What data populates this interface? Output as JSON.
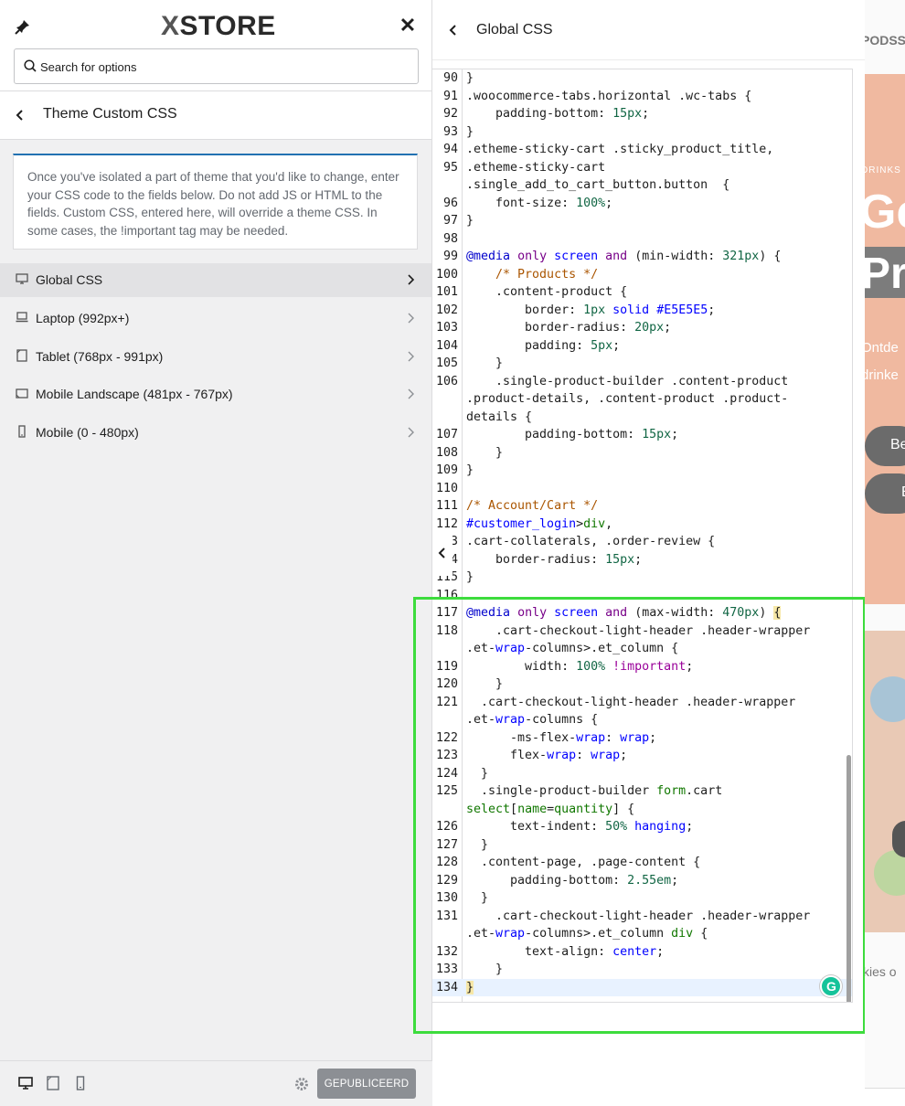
{
  "left_panel": {
    "logo": {
      "mark": "X",
      "text": "STORE"
    },
    "search": {
      "placeholder": "Search for options",
      "value": ""
    },
    "section_title": "Theme Custom CSS",
    "description": "Once you've isolated a part of theme that you'd like to change, enter your CSS code to the fields below. Do not add JS or HTML to the fields. Custom CSS, entered here, will override a theme CSS. In some cases, the !important tag may be needed.",
    "menu": [
      {
        "label": "Global CSS",
        "icon": "desktop-icon",
        "active": true
      },
      {
        "label": "Laptop (992px+)",
        "icon": "laptop-icon",
        "active": false
      },
      {
        "label": "Tablet (768px - 991px)",
        "icon": "tablet-icon",
        "active": false
      },
      {
        "label": "Mobile Landscape (481px - 767px)",
        "icon": "mobile-landscape-icon",
        "active": false
      },
      {
        "label": "Mobile (0 - 480px)",
        "icon": "mobile-icon",
        "active": false
      }
    ],
    "footer": {
      "publish_label": "GEPUBLICEERD"
    }
  },
  "code_panel": {
    "title": "Global CSS",
    "lines": [
      {
        "n": "90",
        "t": "}"
      },
      {
        "n": "91",
        "t": ".woocommerce-tabs.horizontal .wc-tabs {"
      },
      {
        "n": "92",
        "t": "    padding-bottom: 15px;"
      },
      {
        "n": "93",
        "t": "}"
      },
      {
        "n": "94",
        "t": ".etheme-sticky-cart .sticky_product_title,"
      },
      {
        "n": "95",
        "t": ".etheme-sticky-cart"
      },
      {
        "n": "",
        "t": ".single_add_to_cart_button.button  {"
      },
      {
        "n": "96",
        "t": "    font-size: 100%;"
      },
      {
        "n": "97",
        "t": "}"
      },
      {
        "n": "98",
        "t": ""
      },
      {
        "n": "99",
        "t": "@media only screen and (min-width: 321px) {"
      },
      {
        "n": "100",
        "t": "    /* Products */"
      },
      {
        "n": "101",
        "t": "    .content-product {"
      },
      {
        "n": "102",
        "t": "        border: 1px solid #E5E5E5;"
      },
      {
        "n": "103",
        "t": "        border-radius: 20px;"
      },
      {
        "n": "104",
        "t": "        padding: 5px;"
      },
      {
        "n": "105",
        "t": "    }"
      },
      {
        "n": "106",
        "t": "    .single-product-builder .content-product"
      },
      {
        "n": "",
        "t": ".product-details, .content-product .product-"
      },
      {
        "n": "",
        "t": "details {"
      },
      {
        "n": "107",
        "t": "        padding-bottom: 15px;"
      },
      {
        "n": "108",
        "t": "    }"
      },
      {
        "n": "109",
        "t": "}"
      },
      {
        "n": "110",
        "t": ""
      },
      {
        "n": "111",
        "t": "/* Account/Cart */"
      },
      {
        "n": "112",
        "t": "#customer_login>div,"
      },
      {
        "n": "3",
        "t": ".cart-collaterals, .order-review {"
      },
      {
        "n": "4",
        "t": "    border-radius: 15px;"
      },
      {
        "n": "115",
        "t": "}"
      },
      {
        "n": "116",
        "t": ""
      },
      {
        "n": "117",
        "t": "@media only screen and (max-width: 470px) {"
      },
      {
        "n": "118",
        "t": "    .cart-checkout-light-header .header-wrapper"
      },
      {
        "n": "",
        "t": ".et-wrap-columns>.et_column {"
      },
      {
        "n": "119",
        "t": "        width: 100% !important;"
      },
      {
        "n": "120",
        "t": "    }"
      },
      {
        "n": "121",
        "t": "  .cart-checkout-light-header .header-wrapper"
      },
      {
        "n": "",
        "t": ".et-wrap-columns {"
      },
      {
        "n": "122",
        "t": "      -ms-flex-wrap: wrap;"
      },
      {
        "n": "123",
        "t": "      flex-wrap: wrap;"
      },
      {
        "n": "124",
        "t": "  }"
      },
      {
        "n": "125",
        "t": "  .single-product-builder form.cart"
      },
      {
        "n": "",
        "t": "select[name=quantity] {"
      },
      {
        "n": "126",
        "t": "      text-indent: 50% hanging;"
      },
      {
        "n": "127",
        "t": "  }"
      },
      {
        "n": "128",
        "t": "  .content-page, .page-content {"
      },
      {
        "n": "129",
        "t": "      padding-bottom: 2.55em;"
      },
      {
        "n": "130",
        "t": "  }"
      },
      {
        "n": "131",
        "t": "    .cart-checkout-light-header .header-wrapper"
      },
      {
        "n": "",
        "t": ".et-wrap-columns>.et_column div {"
      },
      {
        "n": "132",
        "t": "        text-align: center;"
      },
      {
        "n": "133",
        "t": "    }"
      },
      {
        "n": "134",
        "t": "}"
      }
    ],
    "grammarly_mark": "G"
  },
  "preview": {
    "brand": "PODSS",
    "eyebrow": "DRINKS",
    "headline_1": "Ge",
    "headline_2": "Pr",
    "sub_1": "Ontde",
    "sub_2": "drinke",
    "button_1": "Be",
    "button_2": "E",
    "cookie": "kies o"
  },
  "colors": {
    "accent": "#2271b1",
    "highlight": "#3ddc3d",
    "publish_button": "#8c8f94",
    "hero": "#f0b9a0"
  }
}
